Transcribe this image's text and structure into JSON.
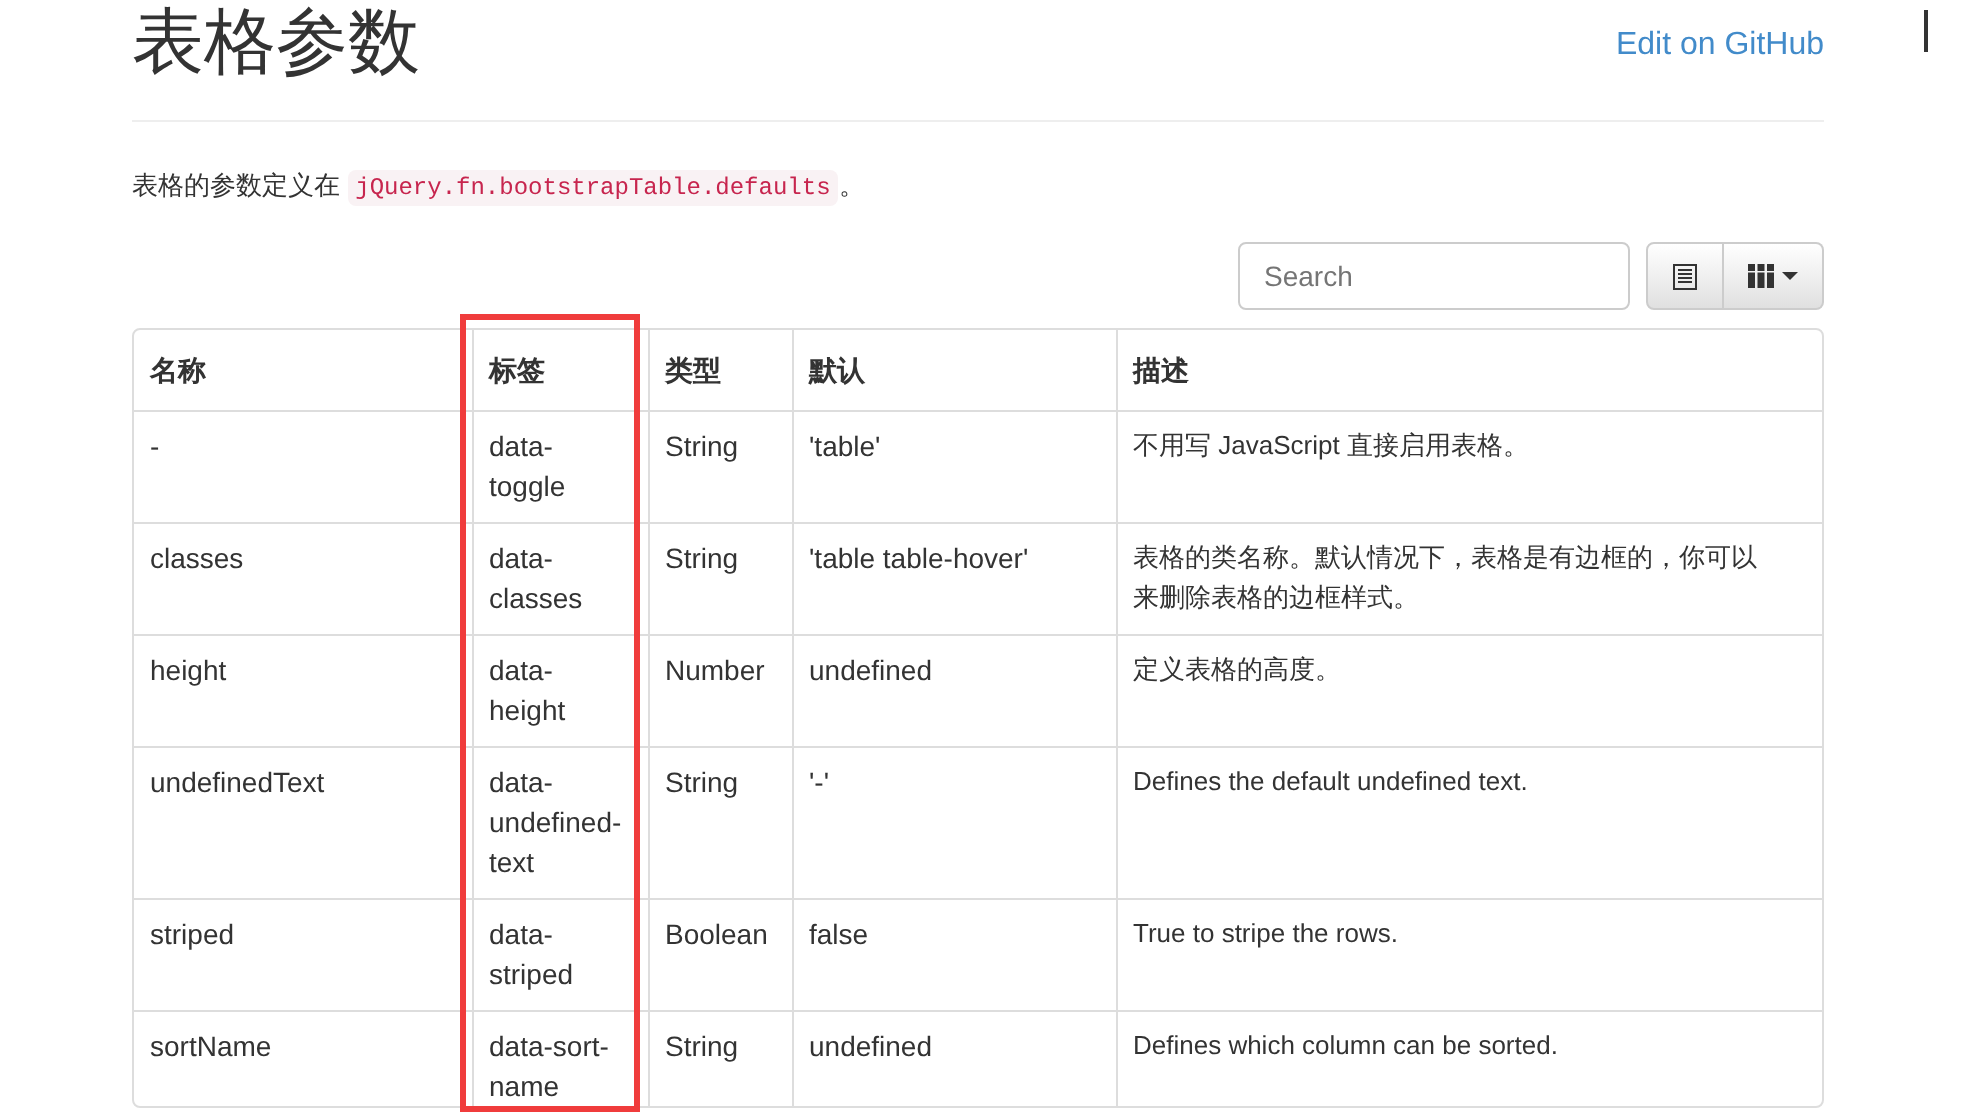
{
  "page": {
    "title": "表格参数",
    "edit_link": "Edit on GitHub",
    "intro": "表格的参数定义在 ",
    "intro_code": "jQuery.fn.bootstrapTable.defaults",
    "intro_end": "。"
  },
  "toolbar": {
    "search": {
      "placeholder": "Search"
    }
  },
  "table": {
    "columns": [
      {
        "label": "名称",
        "highlighted": false
      },
      {
        "label": "标签",
        "highlighted": true
      },
      {
        "label": "类型",
        "highlighted": false
      },
      {
        "label": "默认",
        "highlighted": false
      },
      {
        "label": "描述",
        "highlighted": false
      }
    ],
    "rows": [
      [
        "-",
        "data-toggle",
        "String",
        "'table'",
        [
          "不用写 JavaScript 直接启用表格。"
        ]
      ],
      [
        "classes",
        "data-classes",
        "String",
        "'table table-hover'",
        [
          "表格的类名称。默认情况下，表格是有边框的，你可以",
          "来删除表格的边框样式。"
        ]
      ],
      [
        "height",
        "data-height",
        "Number",
        "undefined",
        [
          "定义表格的高度。"
        ]
      ],
      [
        "undefinedText",
        "data-undefined-text",
        "String",
        "'-'",
        [
          "Defines the default undefined text."
        ]
      ],
      [
        "striped",
        "data-striped",
        "Boolean",
        "false",
        [
          "True to stripe the rows."
        ]
      ],
      [
        "sortName",
        "data-sort-name",
        "String",
        "undefined",
        [
          "Defines which column can be sorted."
        ]
      ]
    ]
  }
}
